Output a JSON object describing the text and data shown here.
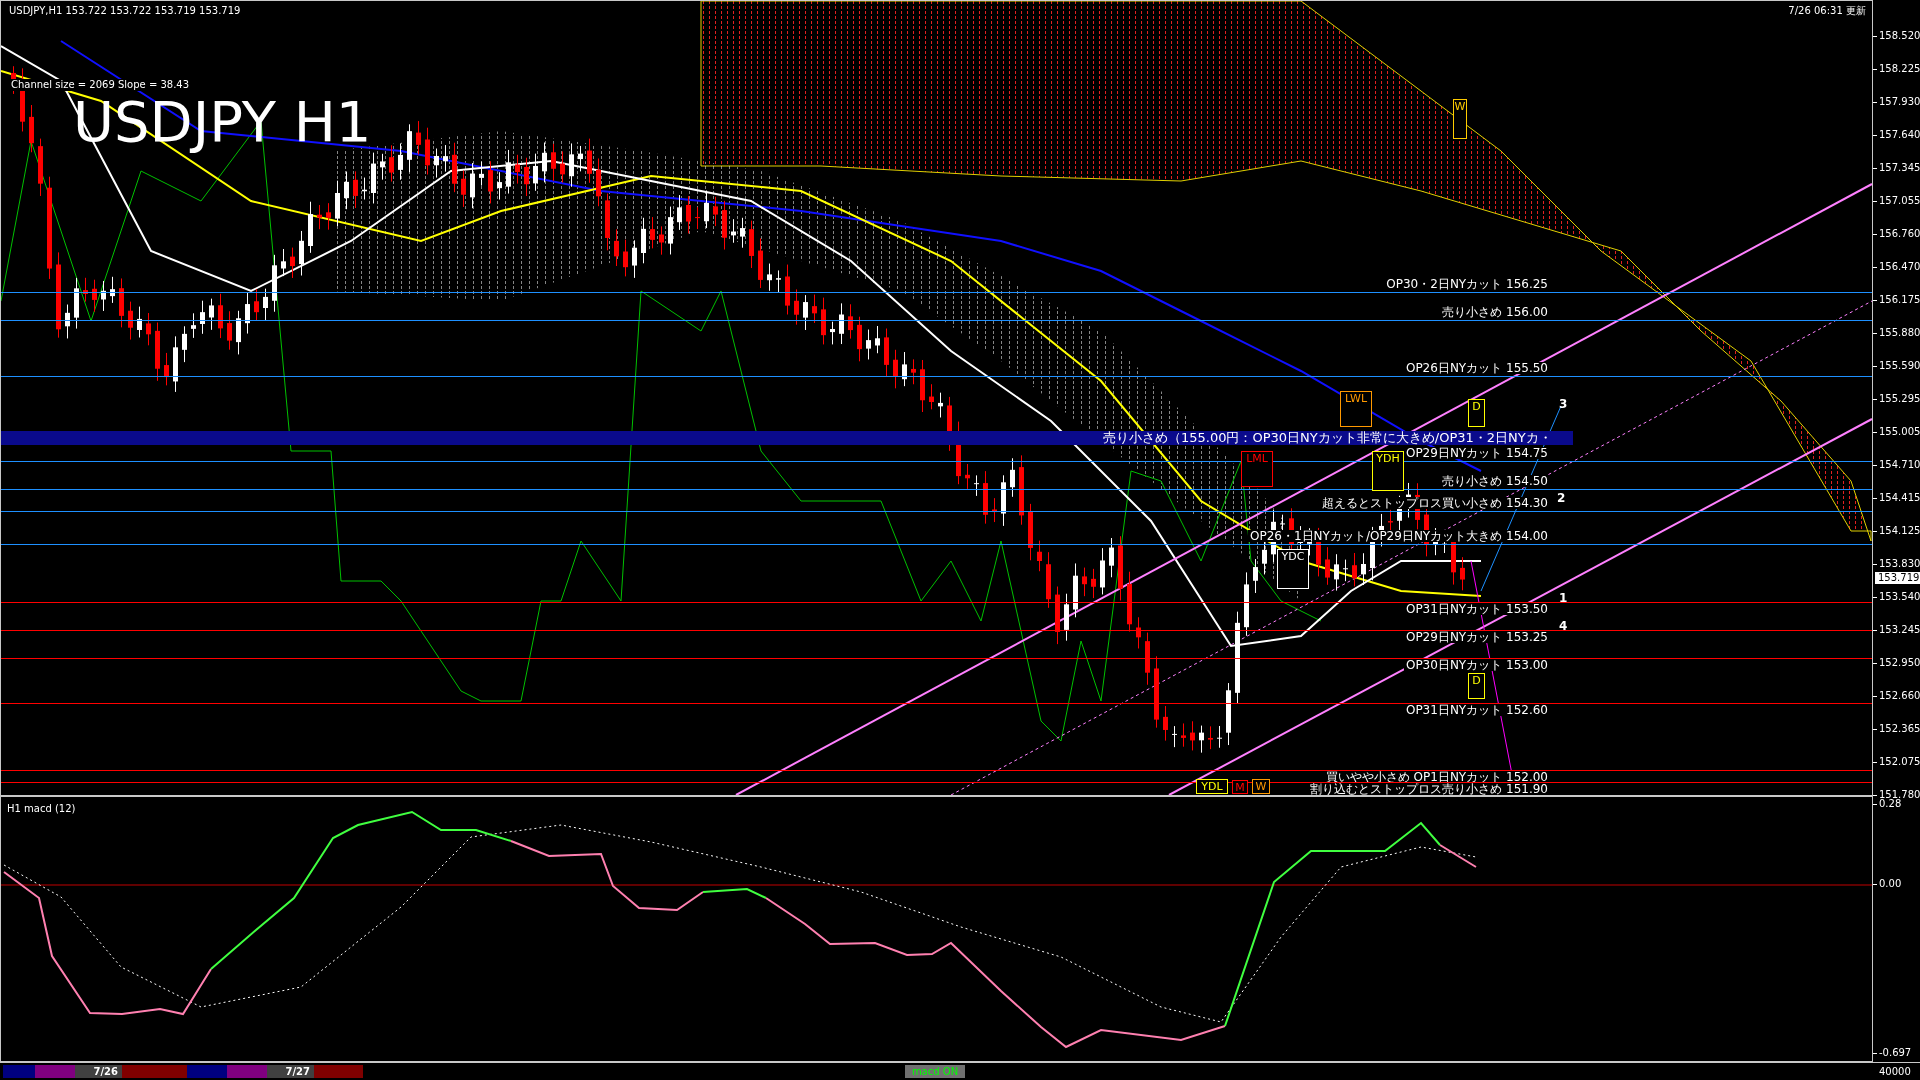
{
  "header": {
    "symbol": "USDJPY,H1",
    "quotes": [
      "153.722",
      "153.722",
      "153.719",
      "153.719"
    ]
  },
  "chart_title": "USDJPY H1",
  "channel_info": "Channel size = 2069 Slope = 38.43",
  "updated": "7/26 06:31 更新",
  "price_axis": [
    "158.520",
    "158.225",
    "157.930",
    "157.640",
    "157.345",
    "157.055",
    "156.760",
    "156.470",
    "156.175",
    "155.880",
    "155.590",
    "155.295",
    "155.005",
    "154.710",
    "154.415",
    "154.125",
    "153.830",
    "153.540",
    "153.245",
    "152.950",
    "152.660",
    "152.365",
    "152.075",
    "151.780"
  ],
  "current_price": "153.719",
  "levels": [
    {
      "kind": "above",
      "label": "OP30・2日NYカット 156.25",
      "color": "#1e90ff"
    },
    {
      "kind": "above",
      "label": "売り小さめ 156.00",
      "color": "#1e90ff"
    },
    {
      "kind": "above",
      "label": "OP26日NYカット 155.50",
      "color": "#1e90ff"
    },
    {
      "kind": "banner",
      "label": "売り小さめ（155.00円：OP30日NYカット非常に大きめ/OP31・2日NYカ・",
      "color": "#0a0a8c"
    },
    {
      "kind": "above",
      "label": "OP29日NYカット 154.75",
      "color": "#1e90ff"
    },
    {
      "kind": "above",
      "label": "売り小さめ 154.50",
      "color": "#1e90ff"
    },
    {
      "kind": "above",
      "label": "超えるとストップロス買い小さめ 154.30",
      "color": "#1e90ff"
    },
    {
      "kind": "above",
      "label": "OP26・1日NYカット/OP29日NYカット大きめ 154.00",
      "color": "#1e90ff"
    },
    {
      "kind": "below",
      "label": "OP31日NYカット 153.50",
      "color": "#ff0000"
    },
    {
      "kind": "below",
      "label": "OP29日NYカット 153.25",
      "color": "#ff0000"
    },
    {
      "kind": "below",
      "label": "OP30日NYカット 153.00",
      "color": "#ff0000"
    },
    {
      "kind": "below",
      "label": "OP31日NYカット 152.60",
      "color": "#ff0000"
    },
    {
      "kind": "below",
      "label": "買いやや小さめ OP1日NYカット 152.00",
      "color": "#ff0000"
    },
    {
      "kind": "below",
      "label": "割り込むとストップロス売り小さめ 151.90",
      "color": "#ff0000"
    }
  ],
  "tags": [
    {
      "label": "W",
      "color": "#ffcc00"
    },
    {
      "label": "LWL",
      "color": "#ff9900"
    },
    {
      "label": "D",
      "color": "#ffff00"
    },
    {
      "label": "YDH",
      "color": "#ffff00"
    },
    {
      "label": "LML",
      "color": "#ff0000"
    },
    {
      "label": "YDC",
      "color": "#ffffff"
    },
    {
      "label": "D",
      "color": "#ffff00"
    },
    {
      "label": "YDL",
      "color": "#ffff00"
    },
    {
      "label": "M",
      "color": "#ff0000"
    },
    {
      "label": "W",
      "color": "#ff9900"
    }
  ],
  "wave_labels": [
    "3",
    "2",
    "1",
    "4"
  ],
  "macd": {
    "title": "H1  macd (12)",
    "axis": [
      "0.28",
      "0.00",
      "-0.697"
    ]
  },
  "volume_axis": "40000",
  "date_bar": [
    {
      "color": "#000080"
    },
    {
      "color": "#800080"
    },
    {
      "label": "7/26",
      "color": "#404040"
    },
    {
      "color": "#800000"
    },
    {
      "color": "#000080"
    },
    {
      "color": "#800080"
    },
    {
      "label": "7/27",
      "color": "#404040"
    },
    {
      "color": "#800000"
    }
  ],
  "macd_toggle": {
    "label": "macd ON",
    "on": true
  }
}
